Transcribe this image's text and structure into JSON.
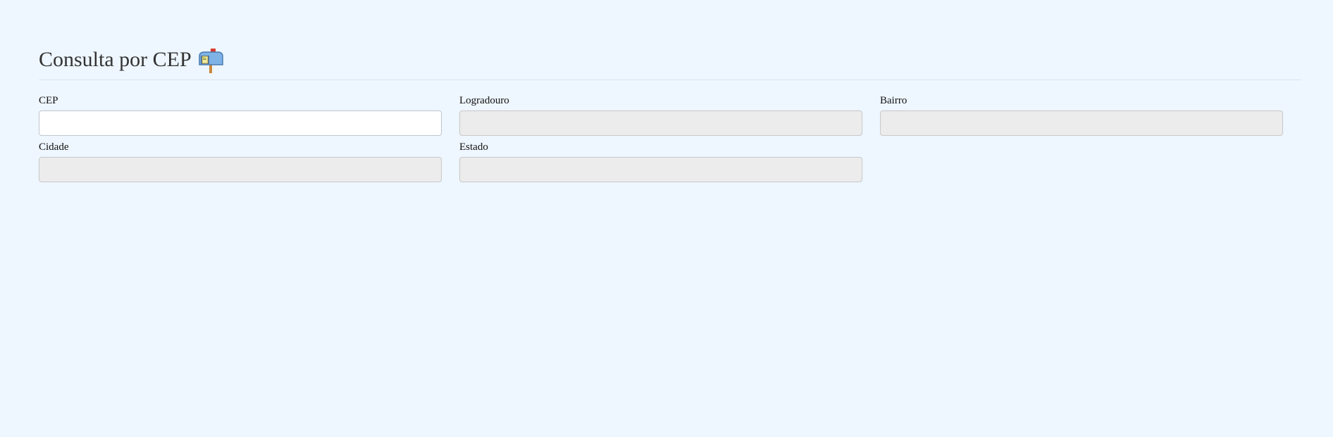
{
  "header": {
    "title": "Consulta por CEP",
    "icon": "mailbox-with-raised-flag-icon"
  },
  "form": {
    "cep": {
      "label": "CEP",
      "value": "",
      "placeholder": ""
    },
    "logradouro": {
      "label": "Logradouro",
      "value": "",
      "placeholder": ""
    },
    "bairro": {
      "label": "Bairro",
      "value": "",
      "placeholder": ""
    },
    "cidade": {
      "label": "Cidade",
      "value": "",
      "placeholder": ""
    },
    "estado": {
      "label": "Estado",
      "value": "",
      "placeholder": ""
    }
  },
  "colors": {
    "background": "#eef6ff",
    "title": "#333333",
    "readonly_input": "#ececec",
    "editable_input": "#ffffff"
  }
}
